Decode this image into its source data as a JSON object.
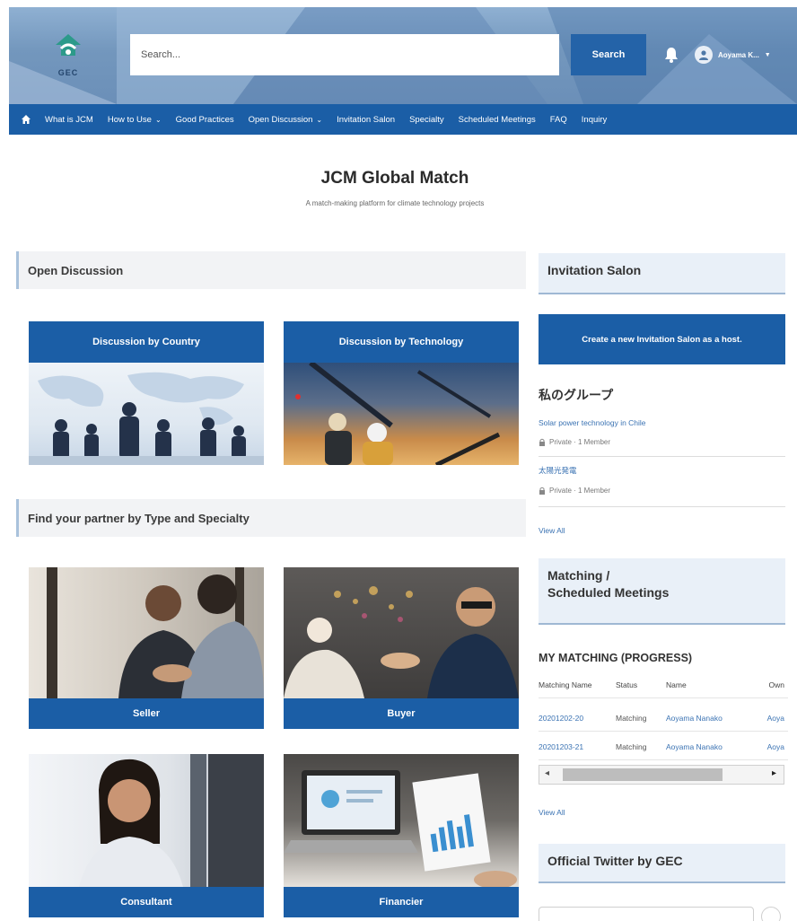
{
  "header": {
    "logo_text": "GEC",
    "search_placeholder": "Search...",
    "search_button": "Search",
    "user_name": "Aoyama K..."
  },
  "nav": {
    "items": [
      {
        "label": "What is JCM",
        "dropdown": false
      },
      {
        "label": "How to Use",
        "dropdown": true
      },
      {
        "label": "Good Practices",
        "dropdown": false
      },
      {
        "label": "Open Discussion",
        "dropdown": true
      },
      {
        "label": "Invitation Salon",
        "dropdown": false
      },
      {
        "label": "Specialty",
        "dropdown": false
      },
      {
        "label": "Scheduled Meetings",
        "dropdown": false
      },
      {
        "label": "FAQ",
        "dropdown": false
      },
      {
        "label": "Inquiry",
        "dropdown": false
      }
    ],
    "chevron": "⌄"
  },
  "main": {
    "title": "JCM Global Match",
    "subtitle": "A match-making platform for climate technology projects",
    "open_discussion": {
      "heading": "Open Discussion",
      "cards": [
        "Discussion by Country",
        "Discussion by Technology"
      ]
    },
    "partner": {
      "heading": "Find your partner by Type and Specialty",
      "cards": [
        "Seller",
        "Buyer",
        "Consultant",
        "Financier"
      ]
    }
  },
  "sidebar": {
    "invitation_salon": {
      "heading": "Invitation Salon",
      "create_button": "Create a new Invitation Salon as a host.",
      "group_title": "私のグループ",
      "groups": [
        {
          "name": "Solar power technology in Chile",
          "meta": "Private · 1 Member"
        },
        {
          "name": "太陽光発電",
          "meta": "Private · 1 Member"
        }
      ],
      "view_all": "View All"
    },
    "matching": {
      "heading_line1": "Matching /",
      "heading_line2": "Scheduled Meetings",
      "table_title": "MY MATCHING (PROGRESS)",
      "columns": [
        "Matching Name",
        "Status",
        "Name",
        "Own"
      ],
      "rows": [
        [
          "20201202-20",
          "Matching",
          "Aoyama Nanako",
          "Aoya"
        ],
        [
          "20201203-21",
          "Matching",
          "Aoyama Nanako",
          "Aoya"
        ]
      ],
      "scroll_left": "◂",
      "scroll_right": "▸",
      "view_all": "View All"
    },
    "twitter": {
      "heading": "Official Twitter by GEC"
    }
  },
  "colors": {
    "nav_blue": "#1b5ea6",
    "link_blue": "#3b73b3",
    "header_bg": "#7397bd"
  }
}
